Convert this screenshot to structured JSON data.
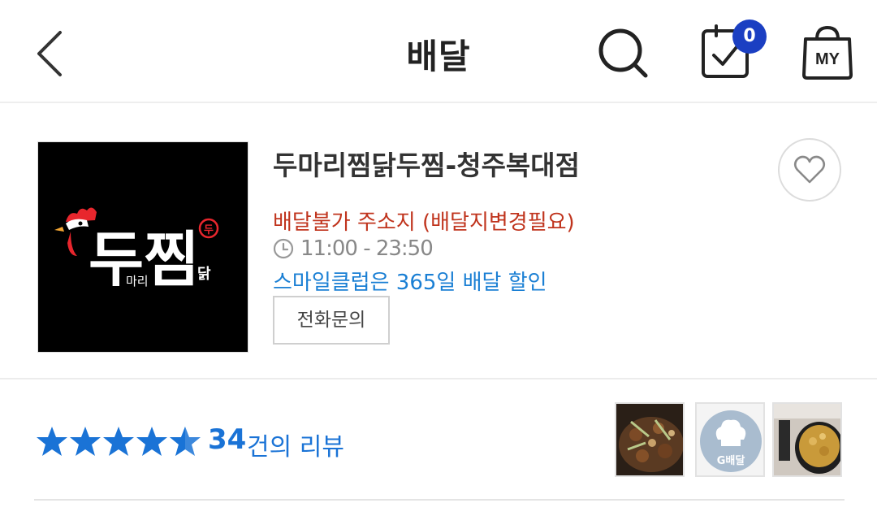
{
  "header": {
    "title": "배달",
    "cart_count": "0",
    "my_label": "MY"
  },
  "store": {
    "name": "두마리찜닭두찜-청주복대점",
    "delivery_warning": "배달불가 주소지 (배달지변경필요)",
    "hours": "11:00 - 23:50",
    "promo": "스마일클럽은 365일 배달 할인",
    "call_button": "전화문의",
    "logo": {
      "main_text": "두찜",
      "sub_text_1": "마리",
      "sub_text_2": "닭",
      "stamp_text": "두"
    }
  },
  "reviews": {
    "rating": 4.5,
    "count": "34",
    "count_suffix": "건의 리뷰",
    "thumbnails": [
      {
        "kind": "food-photo-stirfry"
      },
      {
        "kind": "placeholder",
        "label": "G배달"
      },
      {
        "kind": "food-photo-curry"
      }
    ]
  },
  "colors": {
    "warning": "#c0341d",
    "link": "#1a73d6",
    "badge": "#1b3fc2",
    "star": "#1a73d6"
  }
}
